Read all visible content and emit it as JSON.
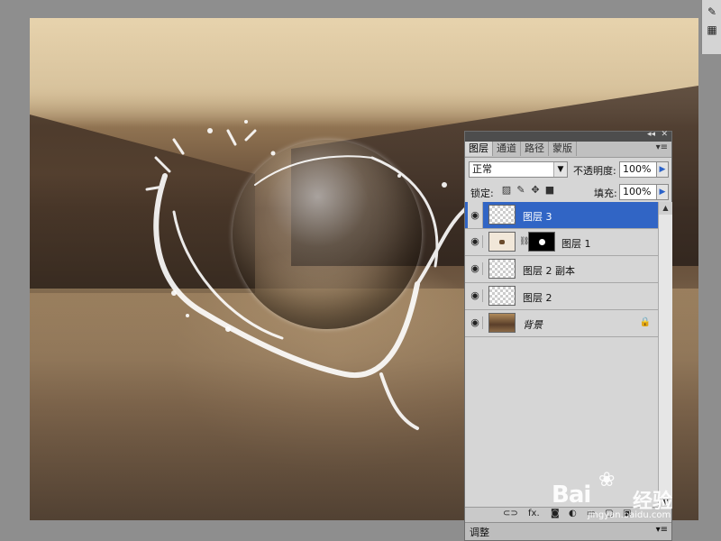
{
  "layers_panel": {
    "tabs": [
      "图层",
      "通道",
      "路径",
      "蒙版"
    ],
    "blend_mode": "正常",
    "opacity_label": "不透明度:",
    "opacity_value": "100%",
    "lock_label": "锁定:",
    "fill_label": "填充:",
    "fill_value": "100%",
    "layers": [
      {
        "name": "图层 3",
        "selected": true
      },
      {
        "name": "图层 1",
        "has_mask": true
      },
      {
        "name": "图层 2 副本"
      },
      {
        "name": "图层 2"
      },
      {
        "name": "背景",
        "locked": true
      }
    ],
    "bottom_tab": "调整"
  },
  "watermark": {
    "brand": "Bai",
    "cn": "经验",
    "url": "jingyan.baidu.com"
  },
  "colors": {
    "selection": "#3165c5",
    "panel_bg": "#d6d6d6",
    "workspace_bg": "#8e8e8e"
  }
}
